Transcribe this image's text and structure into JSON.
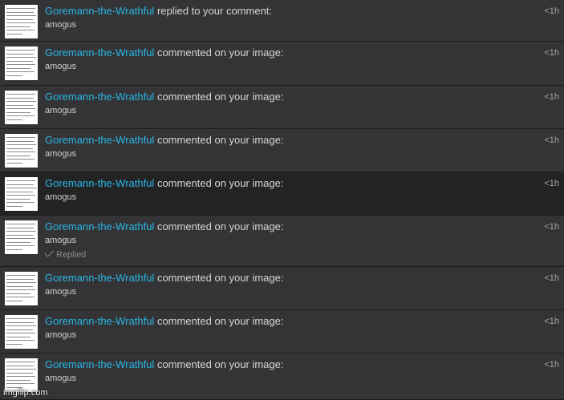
{
  "notifications": [
    {
      "user": "Goremann-the-Wrathful",
      "action": "replied to your comment:",
      "comment": "amogus",
      "time": "<1h",
      "replied": "",
      "hovered": false
    },
    {
      "user": "Goremann-the-Wrathful",
      "action": "commented on your image:",
      "comment": "amogus",
      "time": "<1h",
      "replied": "",
      "hovered": false
    },
    {
      "user": "Goremann-the-Wrathful",
      "action": "commented on your image:",
      "comment": "amogus",
      "time": "<1h",
      "replied": "",
      "hovered": false
    },
    {
      "user": "Goremann-the-Wrathful",
      "action": "commented on your image:",
      "comment": "amogus",
      "time": "<1h",
      "replied": "",
      "hovered": false
    },
    {
      "user": "Goremann-the-Wrathful",
      "action": "commented on your image:",
      "comment": "amogus",
      "time": "<1h",
      "replied": "",
      "hovered": true
    },
    {
      "user": "Goremann-the-Wrathful",
      "action": "commented on your image:",
      "comment": "amogus",
      "time": "<1h",
      "replied": "Replied",
      "hovered": false
    },
    {
      "user": "Goremann-the-Wrathful",
      "action": "commented on your image:",
      "comment": "amogus",
      "time": "<1h",
      "replied": "",
      "hovered": false
    },
    {
      "user": "Goremann-the-Wrathful",
      "action": "commented on your image:",
      "comment": "amogus",
      "time": "<1h",
      "replied": "",
      "hovered": false
    },
    {
      "user": "Goremann-the-Wrathful",
      "action": "commented on your image:",
      "comment": "amogus",
      "time": "<1h",
      "replied": "",
      "hovered": false
    }
  ],
  "watermark": "imgflip.com",
  "colors": {
    "background": "#343436",
    "hovered_background": "#232324",
    "link": "#29b6e6",
    "text": "#d6d6d6",
    "muted": "#8c8c8c"
  },
  "icons": {
    "thumbnail": "image-thumbnail",
    "replied": "checkmark-icon"
  }
}
